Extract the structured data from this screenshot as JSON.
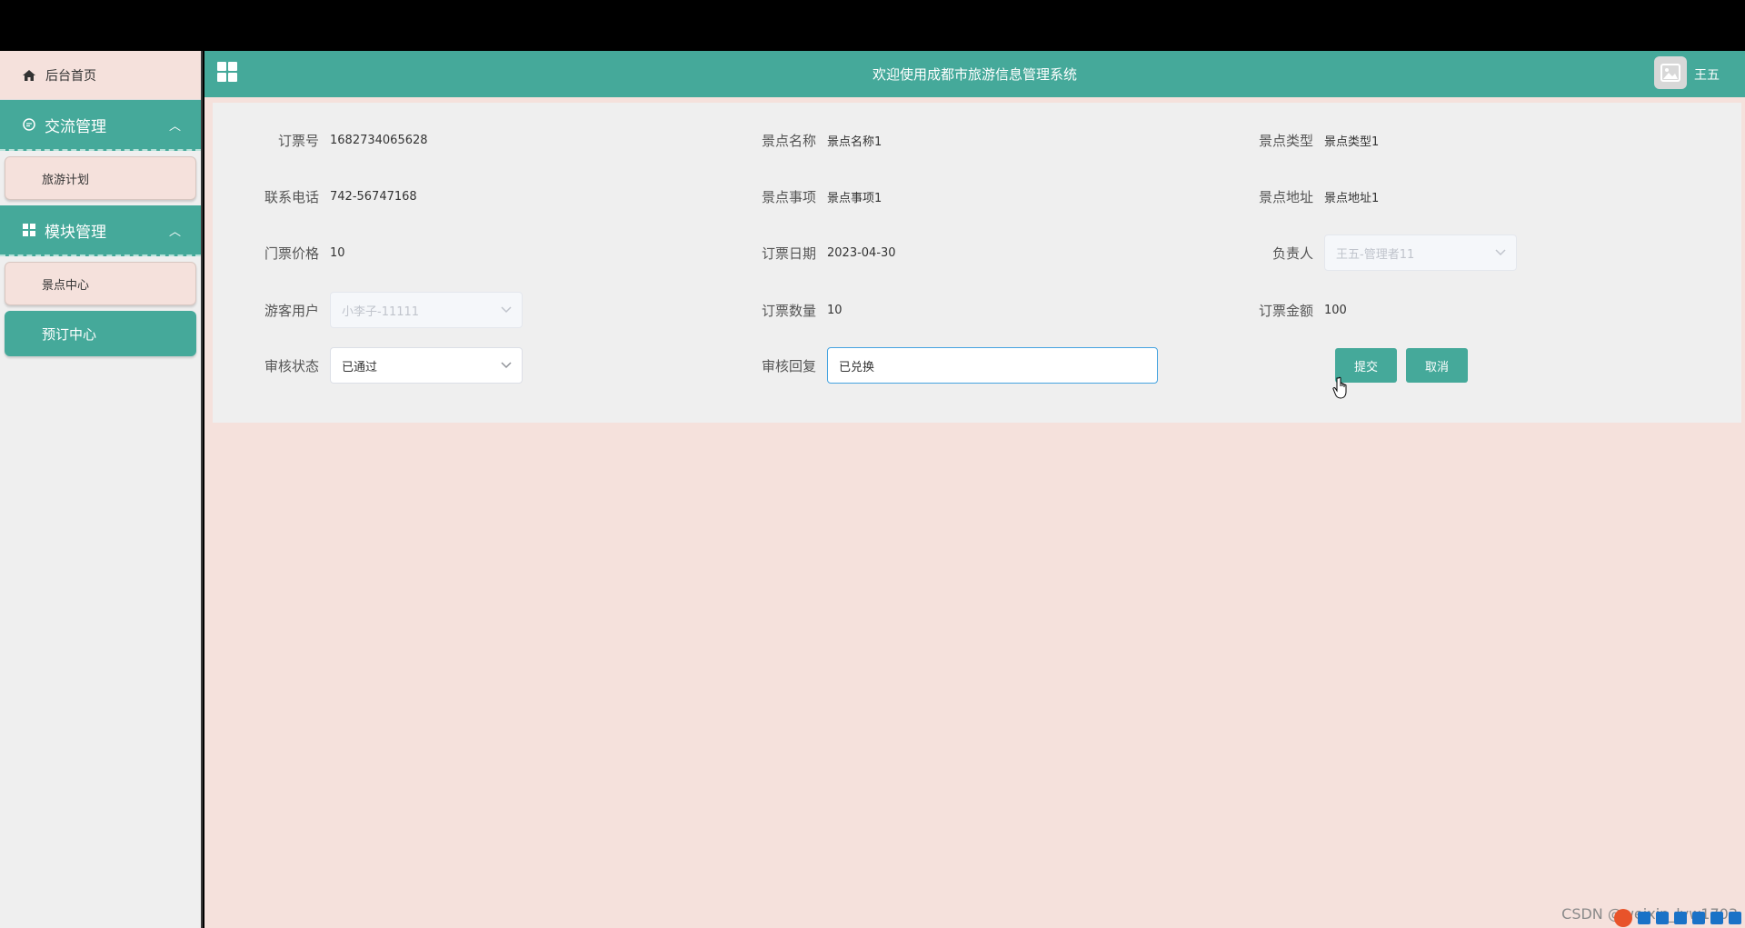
{
  "sidebar": {
    "home_label": "后台首页",
    "groups": [
      {
        "label": "交流管理",
        "items": [
          "旅游计划"
        ]
      },
      {
        "label": "模块管理",
        "items": [
          "景点中心",
          "预订中心"
        ]
      }
    ]
  },
  "header": {
    "title": "欢迎使用成都市旅游信息管理系统",
    "username": "王五"
  },
  "form": {
    "order_no": {
      "label": "订票号",
      "value": "1682734065628"
    },
    "spot_name": {
      "label": "景点名称",
      "value": "景点名称1"
    },
    "spot_type": {
      "label": "景点类型",
      "value": "景点类型1"
    },
    "phone": {
      "label": "联系电话",
      "value": "742-56747168"
    },
    "spot_item": {
      "label": "景点事项",
      "value": "景点事项1"
    },
    "spot_addr": {
      "label": "景点地址",
      "value": "景点地址1"
    },
    "price": {
      "label": "门票价格",
      "value": "10"
    },
    "date": {
      "label": "订票日期",
      "value": "2023-04-30"
    },
    "manager": {
      "label": "负责人",
      "value": "王五-管理者11"
    },
    "tourist": {
      "label": "游客用户",
      "value": "小李子-11111"
    },
    "quantity": {
      "label": "订票数量",
      "value": "10"
    },
    "amount": {
      "label": "订票金额",
      "value": "100"
    },
    "review_status": {
      "label": "审核状态",
      "value": "已通过"
    },
    "review_reply": {
      "label": "审核回复",
      "value": "已兑换"
    },
    "submit_label": "提交",
    "cancel_label": "取消"
  },
  "footer": {
    "watermark": "CSDN @weixin_lyw1703"
  },
  "colors": {
    "accent": "#45a99a",
    "sidebar_item_bg": "#f5e1dc",
    "page_bg": "#f5e1dc"
  }
}
